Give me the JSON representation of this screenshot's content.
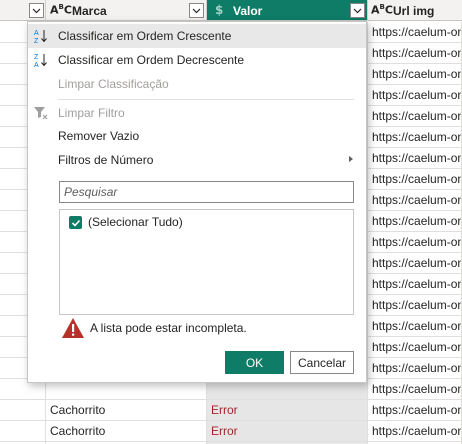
{
  "columns": {
    "marca": {
      "type_icon": "ABC",
      "label": "Marca"
    },
    "valor": {
      "type_icon": "dollar",
      "label": "Valor"
    },
    "url": {
      "type_icon": "ABC",
      "label": "Url img"
    }
  },
  "rows": [
    {
      "url": "https://caelum-onl"
    },
    {
      "url": "https://caelum-onl"
    },
    {
      "url": "https://caelum-onl"
    },
    {
      "url": "https://caelum-onl"
    },
    {
      "url": "https://caelum-onl"
    },
    {
      "url": "https://caelum-onl"
    },
    {
      "url": "https://caelum-onl"
    },
    {
      "url": "https://caelum-onl"
    },
    {
      "url": "https://caelum-onl"
    },
    {
      "url": "https://caelum-onl"
    },
    {
      "url": "https://caelum-onl"
    },
    {
      "url": "https://caelum-onl"
    },
    {
      "url": "https://caelum-onl"
    },
    {
      "url": "https://caelum-onl"
    },
    {
      "url": "https://caelum-onl"
    },
    {
      "url": "https://caelum-onl"
    },
    {
      "url": "https://caelum-onl"
    },
    {
      "url": "https://caelum-onl"
    },
    {
      "marca": "Cachorrito",
      "valor": "Error",
      "url": "https://caelum-onl"
    },
    {
      "marca": "Cachorrito",
      "valor": "Error",
      "url": "https://caelum-onl"
    },
    {
      "marca": "Cachorrito",
      "valor": "Error",
      "url": "https://caelum-onl"
    }
  ],
  "menu": {
    "sort_asc": "Classificar em Ordem Crescente",
    "sort_desc": "Classificar em Ordem Decrescente",
    "clear_sort": "Limpar Classificação",
    "clear_filter": "Limpar Filtro",
    "remove_empty": "Remover Vazio",
    "number_filters": "Filtros de Número"
  },
  "search": {
    "placeholder": "Pesquisar"
  },
  "list": {
    "select_all": "(Selecionar Tudo)"
  },
  "warning": {
    "text": "A lista pode estar incompleta."
  },
  "buttons": {
    "ok": "OK",
    "cancel": "Cancelar"
  },
  "colors": {
    "accent": "#0e7c66",
    "error": "#a4262c",
    "warning": "#b5312a"
  }
}
